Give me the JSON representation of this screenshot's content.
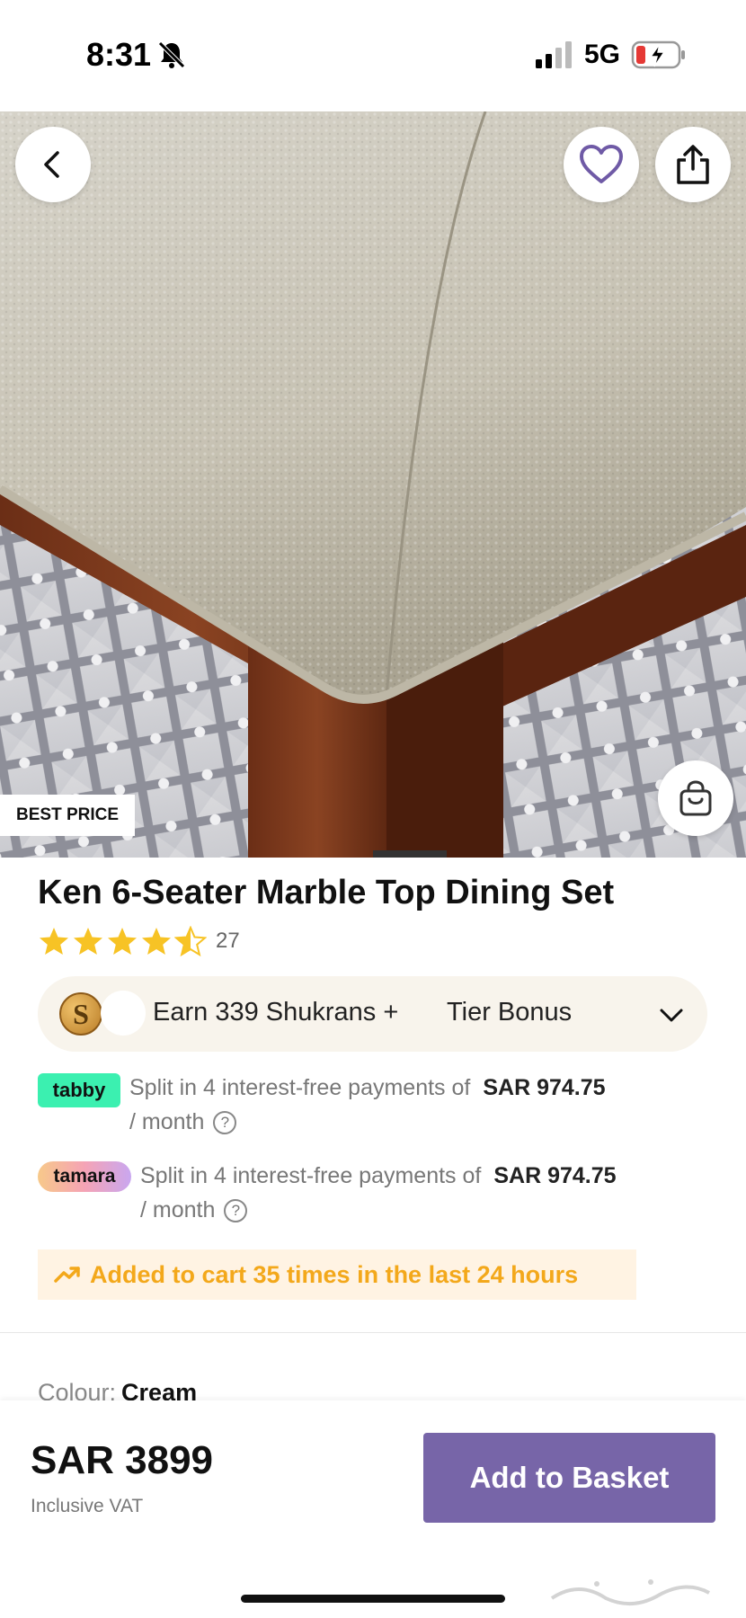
{
  "status_bar": {
    "time": "8:31",
    "network": "5G",
    "icons": [
      "bell-slash-icon",
      "signal-icon",
      "battery-charging-icon"
    ]
  },
  "hero": {
    "badge": "BEST PRICE",
    "icons": [
      "back-icon",
      "heart-icon",
      "share-icon",
      "cart-icon"
    ]
  },
  "product": {
    "title": "Ken 6-Seater Marble Top Dining Set",
    "rating": 4.5,
    "review_count": "27"
  },
  "shukran": {
    "coin_letter": "S",
    "earn_text": "Earn 339 Shukrans +",
    "tier_text": "Tier Bonus"
  },
  "bnpl": {
    "tabby": {
      "logo": "tabby",
      "text": "Split in 4 interest-free payments of",
      "amount": "SAR 974.75",
      "suffix": "/ month",
      "help": "?"
    },
    "tamara": {
      "logo": "tamara",
      "text": "Split in 4 interest-free payments of",
      "amount": "SAR 974.75",
      "suffix": "/ month",
      "help": "?"
    }
  },
  "cart_alert": {
    "text": "Added to cart 35 times in the last 24 hours",
    "color": "#f3a81b"
  },
  "colour": {
    "label": "Colour:",
    "value": "Cream"
  },
  "bottom_bar": {
    "price": "SAR 3899",
    "vat_note": "Inclusive VAT",
    "add_button": "Add to Basket",
    "button_color": "#7765a8"
  }
}
